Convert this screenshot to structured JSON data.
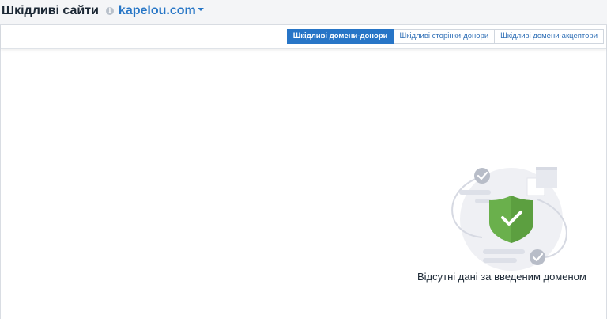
{
  "header": {
    "title": "Шкідливі сайти",
    "domain": "kapelou.com"
  },
  "tabs": [
    {
      "label": "Шкідливі домени-донори",
      "active": true
    },
    {
      "label": "Шкідливі сторінки-донори",
      "active": false
    },
    {
      "label": "Шкідливі домени-акцептори",
      "active": false
    }
  ],
  "empty_state": {
    "message": "Відсутні дані за введеним доменом"
  },
  "colors": {
    "accent": "#2775c7",
    "shield": "#6ab04c",
    "check_badge": "#b8bdc8"
  }
}
